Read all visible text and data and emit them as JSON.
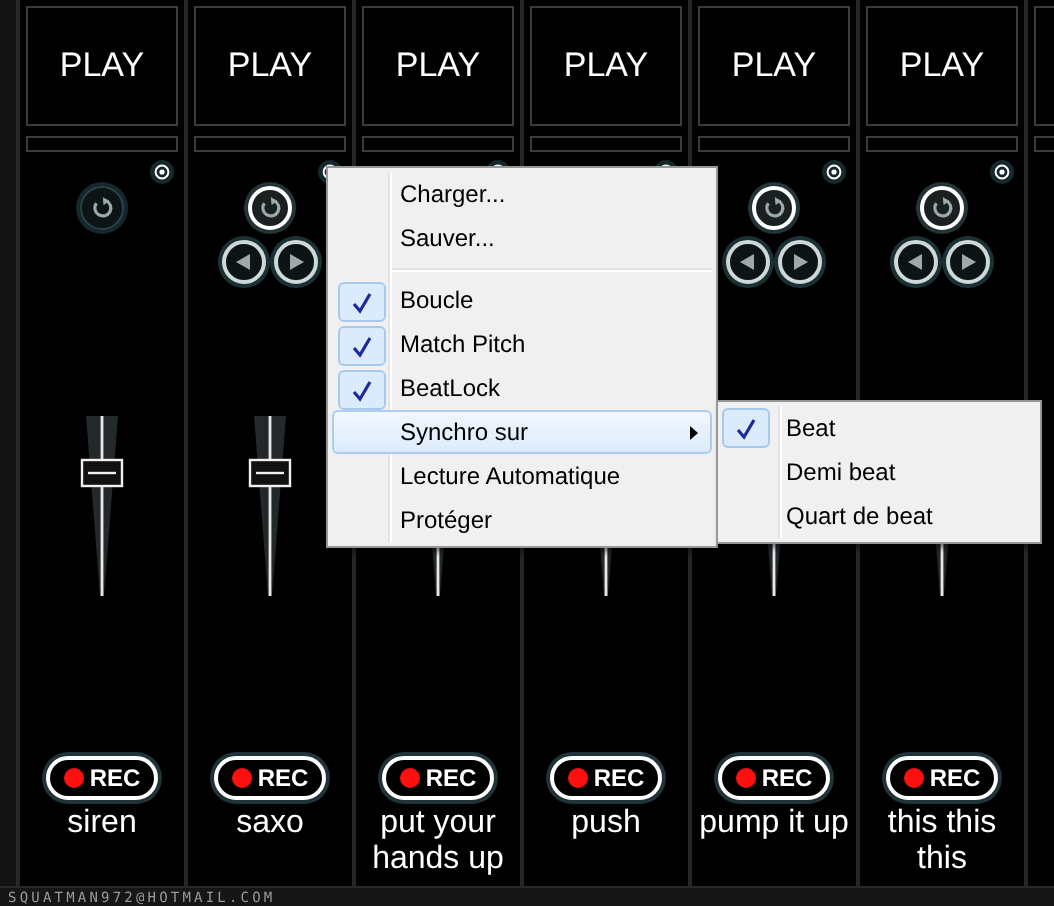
{
  "channels": [
    {
      "play": "PLAY",
      "active": false,
      "level": 0.69,
      "rec": "REC",
      "name": "siren"
    },
    {
      "play": "PLAY",
      "active": true,
      "level": 0.69,
      "rec": "REC",
      "name": "saxo"
    },
    {
      "play": "PLAY",
      "rec": "REC",
      "name": "put your hands up"
    },
    {
      "play": "PLAY",
      "rec": "REC",
      "name": "push"
    },
    {
      "play": "PLAY",
      "active": true,
      "rec": "REC",
      "name": "pump it up"
    },
    {
      "play": "PLAY",
      "active": true,
      "rec": "REC",
      "name": "this this this"
    }
  ],
  "context_menu": {
    "items": [
      {
        "kind": "command",
        "label": "Charger..."
      },
      {
        "kind": "command",
        "label": "Sauver..."
      },
      {
        "kind": "separator"
      },
      {
        "kind": "check",
        "label": "Boucle",
        "checked": true
      },
      {
        "kind": "check",
        "label": "Match Pitch",
        "checked": true
      },
      {
        "kind": "check",
        "label": "BeatLock",
        "checked": true
      },
      {
        "kind": "submenu",
        "label": "Synchro sur",
        "selected": true
      },
      {
        "kind": "command",
        "label": "Lecture Automatique"
      },
      {
        "kind": "command",
        "label": "Protéger"
      }
    ]
  },
  "submenu": {
    "items": [
      {
        "label": "Beat",
        "checked": true
      },
      {
        "label": "Demi beat",
        "checked": false
      },
      {
        "label": "Quart de beat",
        "checked": false
      }
    ]
  },
  "footer": "SQUATMAN972@HOTMAIL.COM"
}
